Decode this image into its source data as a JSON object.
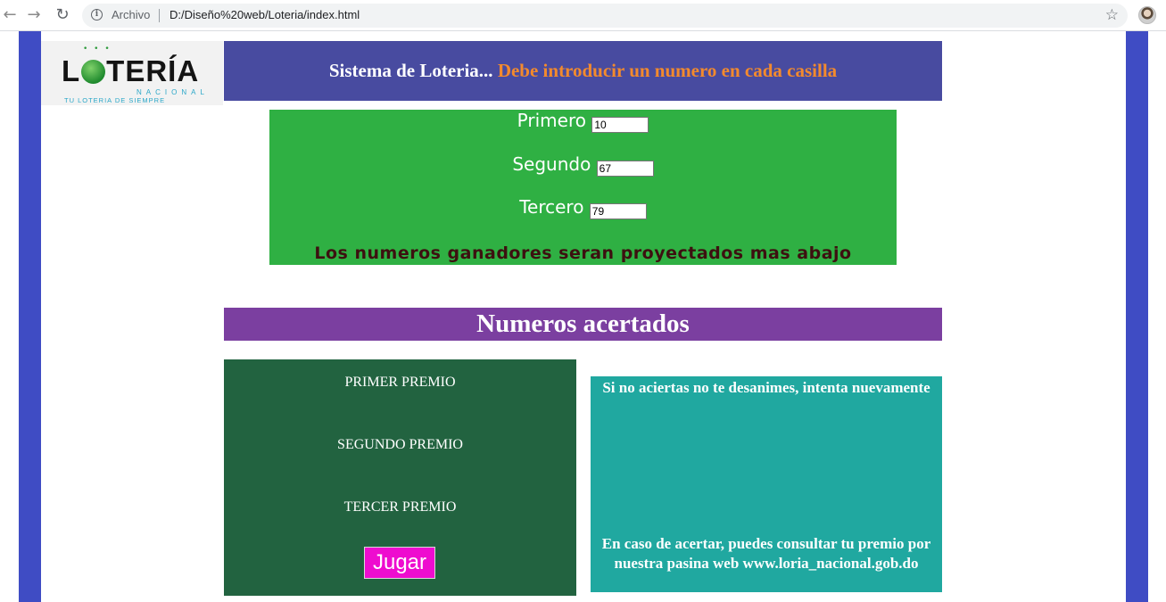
{
  "browser": {
    "back_icon": "arrow-left-icon",
    "forward_icon": "arrow-right-icon",
    "reload_icon": "reload-icon",
    "info_icon": "info-icon",
    "security_label": "Archivo",
    "url": "D:/Diseño%20web/Loteria/index.html",
    "bookmark_icon": "star-icon"
  },
  "logo": {
    "word_left": "L",
    "word_right": "TERÍA",
    "subtitle": "NACIONAL",
    "tagline": "TU LOTERIA DE SIEMPRE"
  },
  "header": {
    "title": "Sistema de Loteria...",
    "warning": "Debe introducir un numero en cada casilla"
  },
  "form": {
    "fields": [
      {
        "label": "Primero",
        "value": "10"
      },
      {
        "label": "Segundo",
        "value": "67"
      },
      {
        "label": "Tercero",
        "value": "79"
      }
    ],
    "note": "Los numeros ganadores seran proyectados mas abajo"
  },
  "results": {
    "title": "Numeros acertados",
    "prizes": [
      "PRIMER PREMIO",
      "SEGUNDO PREMIO",
      "TERCER PREMIO"
    ],
    "play_button": "Jugar"
  },
  "info": {
    "top": "Si no aciertas no te desanimes, intenta nuevamente",
    "bottom": "En caso de acertar, puedes consultar tu premio por nuestra pasina web www.loria_nacional.gob.do"
  },
  "colors": {
    "side_bars": "#3f4cc4",
    "header_bg": "#484ba0",
    "warning_text": "#f38a2d",
    "form_bg": "#2fb043",
    "results_title_bg": "#7b3fa0",
    "prizes_bg": "#226340",
    "play_button_bg": "#ee0ccf",
    "info_bg": "#20a8a0"
  }
}
